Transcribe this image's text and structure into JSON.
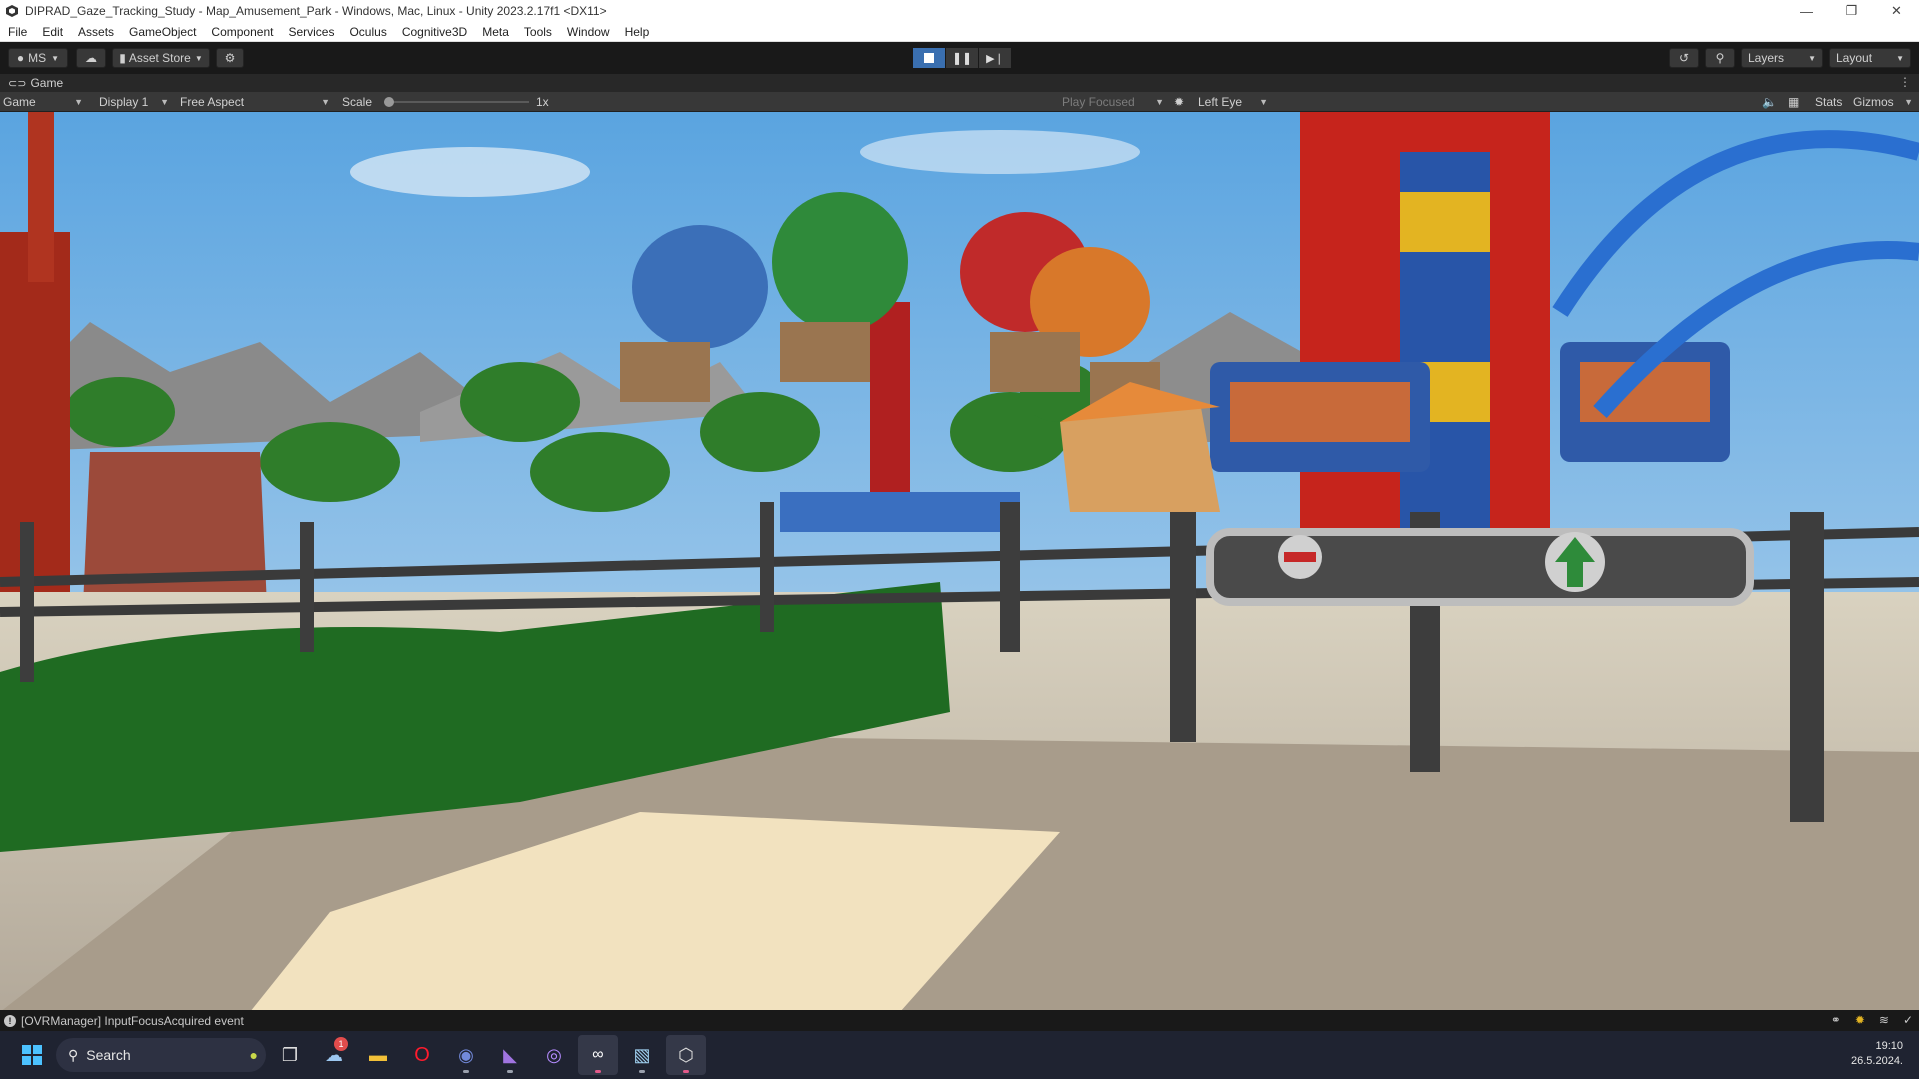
{
  "window": {
    "title": "DIPRAD_Gaze_Tracking_Study - Map_Amusement_Park - Windows, Mac, Linux - Unity 2023.2.17f1 <DX11>",
    "minimize": "—",
    "maximize": "❐",
    "close": "✕"
  },
  "menu": [
    "File",
    "Edit",
    "Assets",
    "GameObject",
    "Component",
    "Services",
    "Oculus",
    "Cognitive3D",
    "Meta",
    "Tools",
    "Window",
    "Help"
  ],
  "toolbar": {
    "account_label": "MS",
    "asset_store_label": "Asset Store",
    "layers_label": "Layers",
    "layout_label": "Layout"
  },
  "game_tab": {
    "tab_label": "Game",
    "mode_dropdown": "Game",
    "display_dropdown": "Display 1",
    "aspect_dropdown": "Free Aspect",
    "scale_label": "Scale",
    "scale_value": "1x",
    "scale_slider_fraction": 0.0,
    "play_focused_dropdown": "Play Focused",
    "eye_dropdown": "Left Eye",
    "stats_label": "Stats",
    "gizmos_label": "Gizmos"
  },
  "status": {
    "message": "[OVRManager] InputFocusAcquired event"
  },
  "taskbar": {
    "search_label": "Search",
    "weather_badge": "1",
    "time": "19:10",
    "date": "26.5.2024."
  },
  "colors": {
    "editor_bg": "#191919",
    "toolbar_button": "#383838",
    "play_active": "#3a6fb0",
    "taskbar_bg": "#1f2331",
    "sky": "#8fc0e8"
  }
}
